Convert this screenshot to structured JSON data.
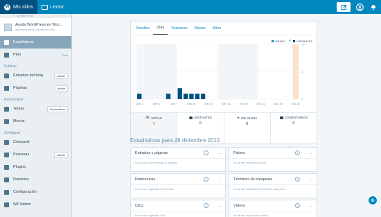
{
  "masterbar": {
    "my_sites": "Mis sitios",
    "reader": "Lector"
  },
  "sidebar": {
    "back": "< Cambiar sitio",
    "site_name": "Ayuda WordPress en Wor...",
    "site_url": "ayudawordpress.wordpress.com",
    "stats": "Estadísticas",
    "plan": "Plan",
    "plan_badge": "Free",
    "publish_header": "Publicar",
    "posts": "Entradas del blog",
    "pages": "Páginas",
    "add": "Añadir",
    "personalize_header": "Personalizar",
    "themes": "Temas",
    "customize": "Personalizar",
    "menus": "Menús",
    "configure_header": "Configurar",
    "share": "Compartir",
    "people": "Personas",
    "plugins": "Plugins",
    "domains": "Dominios",
    "settings": "Configuración",
    "wp_admin": "WP Admin"
  },
  "tabs": [
    "Detalles",
    "Días",
    "Semanas",
    "Meses",
    "Años"
  ],
  "active_tab": 1,
  "legend": {
    "views": "VISTAS",
    "visitors": "VISITANTES"
  },
  "chart_data": {
    "type": "bar",
    "x_tick_labels": [
      "Dec 1",
      "Dec 4",
      "Dec 7",
      "Dec 10",
      "Dec 13",
      "Dec 16",
      "Dec 19",
      "Dec 22",
      "Dec 25",
      "Dec 28"
    ],
    "y_ticks": [
      0,
      5,
      10
    ],
    "ylim": [
      0,
      10
    ],
    "bar_days": [
      1,
      2,
      3,
      4,
      5,
      6,
      7,
      8,
      9,
      10,
      11,
      12,
      13,
      14,
      15,
      16,
      17,
      18,
      19,
      20,
      21,
      22,
      23,
      24,
      25,
      26,
      27,
      28
    ],
    "values": [
      1,
      0,
      0,
      0,
      0,
      1,
      0,
      2,
      1,
      1,
      1,
      1,
      0,
      0,
      0,
      0,
      0,
      0,
      0,
      0,
      0,
      0,
      0,
      0,
      0,
      0,
      0,
      0
    ],
    "highlight_day": 28,
    "colors": {
      "bar": "#005082",
      "column_bg": "#f3f6f8",
      "highlight": "#fbe2cc",
      "views": "#0087be",
      "visitors": "#003f5a"
    }
  },
  "summary": [
    {
      "label": "VISTAS",
      "value": "0"
    },
    {
      "label": "VISITANTES",
      "value": "0"
    },
    {
      "label": "ME GUSTA",
      "value": "0"
    },
    {
      "label": "COMENTARIOS",
      "value": "0"
    }
  ],
  "section_title": "Estadísticas para 28 diciembre 2015",
  "panels": [
    {
      "title": "Entradas y páginas",
      "empty": "No se han visto entradas ni páginas"
    },
    {
      "title": "Países",
      "empty": "No se han registrado países"
    },
    {
      "title": "Referencias",
      "empty": "No se han registrado referencias"
    },
    {
      "title": "Términos de búsqueda",
      "empty": "No se han registrado términos de búsqueda"
    },
    {
      "title": "Clics",
      "empty": "No se han registrado clics"
    },
    {
      "title": "Vídeos",
      "empty": "No se han reproducido vídeos"
    }
  ]
}
